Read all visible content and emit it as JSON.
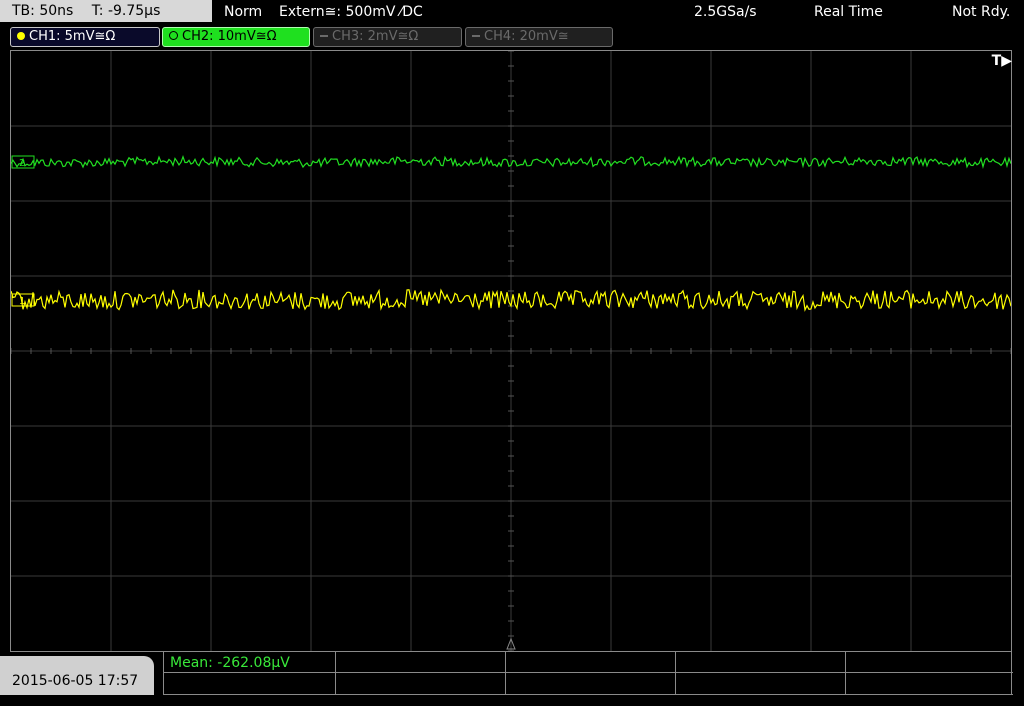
{
  "header": {
    "timebase": "TB: 50ns",
    "trigger_time": "T: -9.75µs",
    "trigger_mode": "Norm",
    "trigger_source": "Extern≅: 500mV ⁄DC",
    "sample_rate": "2.5GSa/s",
    "acquisition": "Real Time",
    "status": "Not Rdy."
  },
  "channels": [
    {
      "label": "CH1: 5mV≅Ω",
      "state": "active",
      "color": "#ffff00"
    },
    {
      "label": "CH2: 10mV≅Ω",
      "state": "selected",
      "color": "#1fe01f"
    },
    {
      "label": "CH3: 2mV≅Ω",
      "state": "off",
      "color": "#6a6a6a"
    },
    {
      "label": "CH4: 20mV≅",
      "state": "off",
      "color": "#6a6a6a"
    }
  ],
  "screen": {
    "trigger_marker": "T▶",
    "markers": [
      {
        "channel": "CH2",
        "label": "2",
        "color": "#1fe01f"
      },
      {
        "channel": "CH1",
        "label": "1",
        "color": "#ffff00"
      }
    ],
    "grid": {
      "h_divs": 10,
      "v_divs": 8
    }
  },
  "footer": {
    "datetime": "2015-06-05 17:57",
    "measurement": "Mean: -262.08µV"
  },
  "colors": {
    "ch1_trace": "#ffff00",
    "ch2_trace": "#22e022",
    "grid": "#3a3a3a",
    "accent_green": "#39e83a"
  }
}
